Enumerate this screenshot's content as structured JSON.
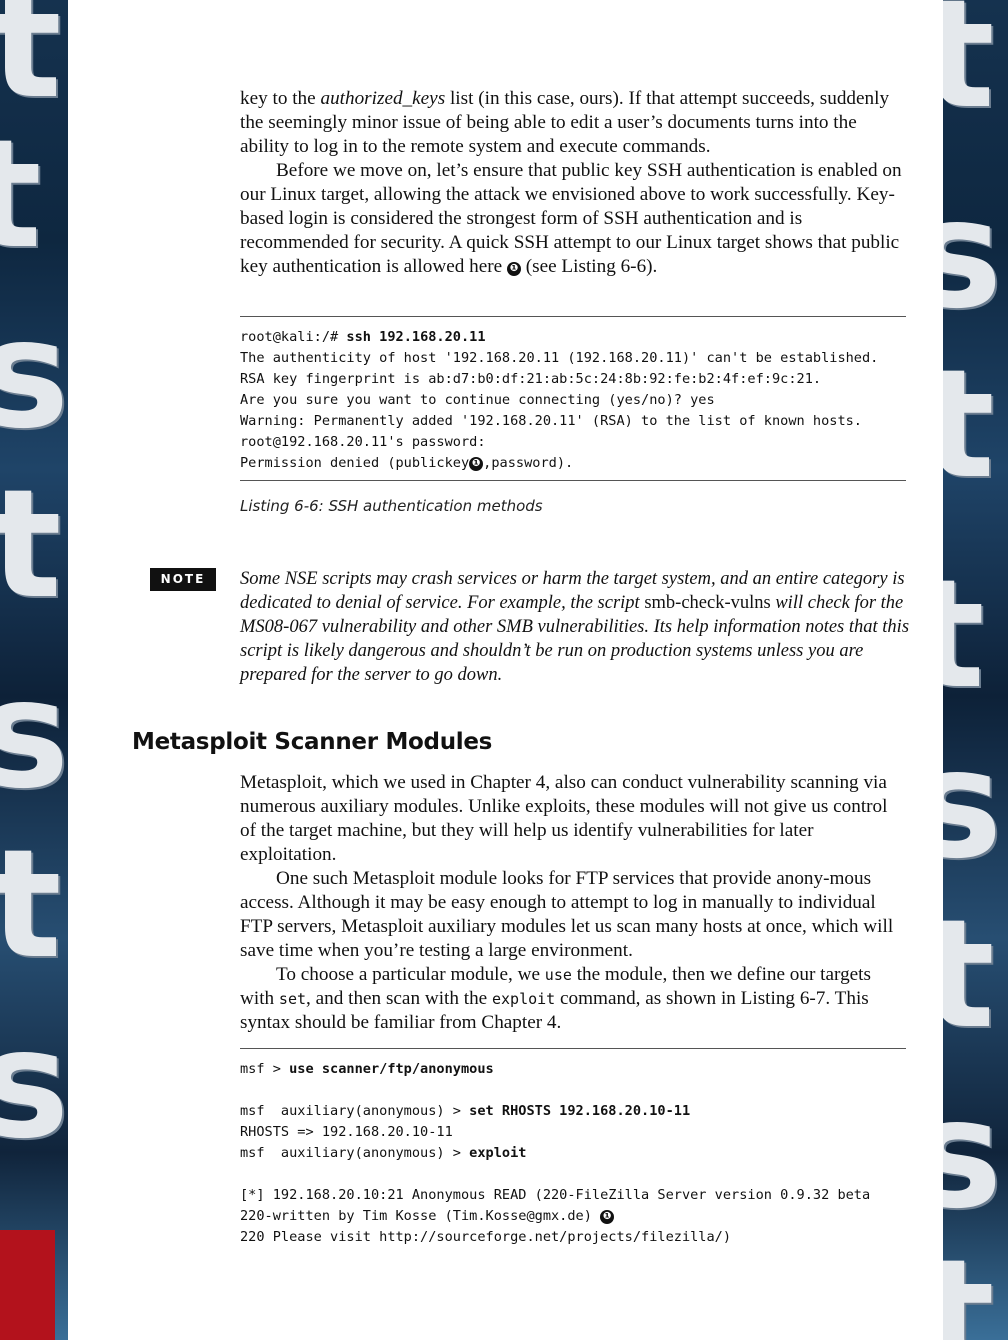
{
  "paragraphs_top": [
    {
      "pre": "key to the ",
      "italic": "authorized_keys",
      "post": " list (in this case, ours). If that attempt succeeds, suddenly the seemingly minor issue of being able to edit a user’s documents turns into the ability to log in to the remote system and execute commands."
    },
    {
      "text": "Before we move on, let’s ensure that public key SSH authentication is enabled on our Linux target, allowing the attack we envisioned above to work successfully. Key-based login is considered the strongest form of SSH authentication and is recommended for security. A quick SSH attempt to our Linux target shows that public key authentication is allowed here ",
      "marker": "❶",
      "after": " (see Listing 6-6)."
    }
  ],
  "listing_6_6": {
    "lines": [
      {
        "prompt": "root@kali:/# ",
        "cmd": "ssh 192.168.20.11"
      },
      {
        "text": "The authenticity of host '192.168.20.11 (192.168.20.11)' can't be established."
      },
      {
        "text": "RSA key fingerprint is ab:d7:b0:df:21:ab:5c:24:8b:92:fe:b2:4f:ef:9c:21."
      },
      {
        "text": "Are you sure you want to continue connecting (yes/no)? yes"
      },
      {
        "text": "Warning: Permanently added '192.168.20.11' (RSA) to the list of known hosts."
      },
      {
        "text": "root@192.168.20.11's password:"
      },
      {
        "pre": "Permission denied (publickey",
        "marker": "❶",
        "post": ",password)."
      }
    ],
    "caption": "Listing 6-6: SSH authentication methods"
  },
  "note": {
    "tag": "NOTE",
    "pre": "Some NSE scripts may crash services or harm the target system, and an entire category is dedicated to denial of service. For example, the script ",
    "script_name": "smb-check-vulns",
    "post": " will check for the MS08-067 vulnerability and other SMB vulnerabilities. Its help information notes that this script is likely dangerous and shouldn’t be run on production systems unless you are prepared for the server to go down."
  },
  "section_heading": "Metasploit Scanner Modules",
  "paragraphs_bottom": [
    {
      "text": "Metasploit, which we used in Chapter 4, also can conduct vulnerability scanning via numerous auxiliary modules. Unlike exploits, these modules will not give us control of the target machine, but they will help us identify vulnerabilities for later exploitation."
    },
    {
      "text": "One such Metasploit module looks for FTP services that provide anony-mous access. Although it may be easy enough to attempt to log in manually to individual FTP servers, Metasploit auxiliary modules let us scan many hosts at once, which will save time when you’re testing a large environment."
    },
    {
      "p1": "To choose a particular module, we ",
      "c1": "use",
      "p2": " the module, then we define our targets with ",
      "c2": "set",
      "p3": ", and then scan with the ",
      "c3": "exploit",
      "p4": " command, as shown in Listing 6-7. This syntax should be familiar from Chapter 4."
    }
  ],
  "listing_6_7": {
    "lines": [
      {
        "prompt": "msf > ",
        "cmd": "use scanner/ftp/anonymous"
      },
      {
        "text": ""
      },
      {
        "prompt": "msf  auxiliary(anonymous) > ",
        "cmd": "set RHOSTS 192.168.20.10-11"
      },
      {
        "text": "RHOSTS => 192.168.20.10-11"
      },
      {
        "prompt": "msf  auxiliary(anonymous) > ",
        "cmd": "exploit"
      },
      {
        "text": ""
      },
      {
        "text": "[*] 192.168.20.10:21 Anonymous READ (220-FileZilla Server version 0.9.32 beta"
      },
      {
        "pre": "220-written by Tim Kosse (Tim.Kosse@gmx.de) ",
        "marker": "❶",
        "post": ""
      },
      {
        "text": "220 Please visit http://sourceforge.net/projects/filezilla/)"
      }
    ]
  },
  "colors": {
    "side_strip": "#15324f",
    "red_accent": "#b3121c",
    "text": "#111111"
  }
}
